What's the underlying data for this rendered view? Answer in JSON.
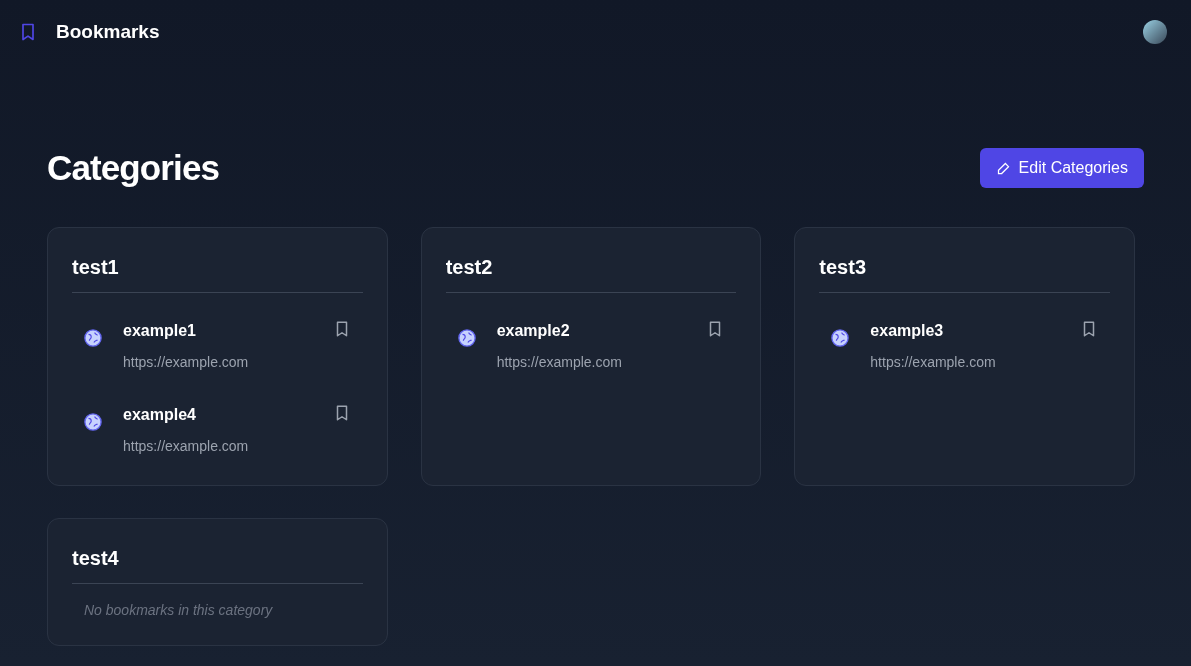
{
  "header": {
    "title": "Bookmarks"
  },
  "page": {
    "title": "Categories",
    "edit_button": "Edit Categories"
  },
  "categories": [
    {
      "name": "test1",
      "bookmarks": [
        {
          "title": "example1",
          "url": "https://example.com"
        },
        {
          "title": "example4",
          "url": "https://example.com"
        }
      ]
    },
    {
      "name": "test2",
      "bookmarks": [
        {
          "title": "example2",
          "url": "https://example.com"
        }
      ]
    },
    {
      "name": "test3",
      "bookmarks": [
        {
          "title": "example3",
          "url": "https://example.com"
        }
      ]
    },
    {
      "name": "test4",
      "empty_text": "No bookmarks in this category"
    }
  ]
}
